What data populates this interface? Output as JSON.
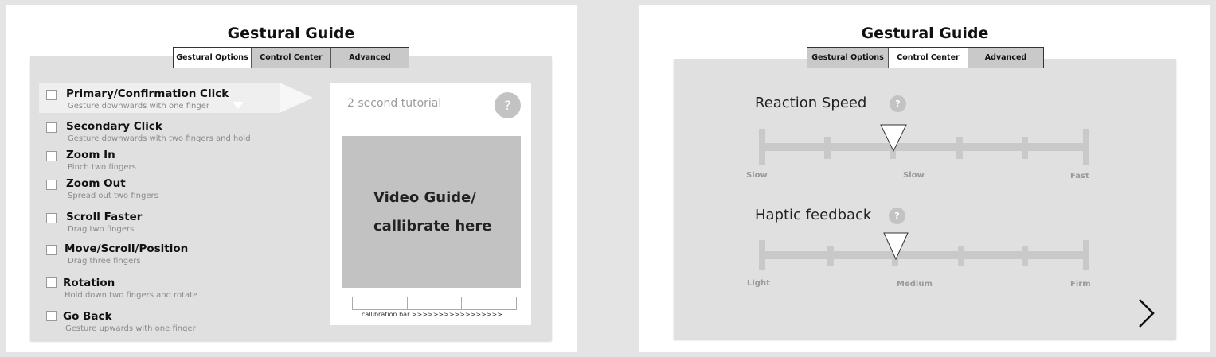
{
  "left_screen": {
    "title": "Gestural Guide",
    "tabs": [
      {
        "label": "Gestural Options",
        "active": true
      },
      {
        "label": "Control Center",
        "active": false
      },
      {
        "label": "Advanced",
        "active": false
      }
    ],
    "gestures": [
      {
        "name": "Primary/Confirmation Click",
        "desc": "Gesture downwards with one finger"
      },
      {
        "name": "Secondary Click",
        "desc": "Gesture downwards with two fingers and hold"
      },
      {
        "name": "Zoom In",
        "desc": "Pinch two fingers"
      },
      {
        "name": "Zoom Out",
        "desc": "Spread out two fingers"
      },
      {
        "name": "Scroll Faster",
        "desc": "Drag two fingers"
      },
      {
        "name": "Move/Scroll/Position",
        "desc": "Drag three fingers"
      },
      {
        "name": "Rotation",
        "desc": "Hold down two fingers and rotate"
      },
      {
        "name": "Go Back",
        "desc": "Gesture upwards with one finger"
      }
    ],
    "tutorial": {
      "label": "2 second tutorial",
      "help": "?",
      "video_line1": "Video Guide/",
      "video_line2": "callibrate here",
      "calibration_label": "callibration bar >>>>>>>>>>>>>>>>>"
    }
  },
  "right_screen": {
    "title": "Gestural Guide",
    "tabs": [
      {
        "label": "Gestural Options",
        "active": false
      },
      {
        "label": "Control Center",
        "active": true
      },
      {
        "label": "Advanced",
        "active": false
      }
    ],
    "reaction_speed": {
      "title": "Reaction Speed",
      "help": "?",
      "labels": [
        "Slow",
        "Slow",
        "Fast"
      ],
      "position": 2
    },
    "haptic_feedback": {
      "title": "Haptic feedback",
      "help": "?",
      "labels": [
        "Light",
        "Medium",
        "Firm"
      ],
      "position": 2
    }
  },
  "colors": {
    "panel": "#e0e0e0",
    "slider_track": "#c9c9c9",
    "inactive_tab": "#c9c9c9"
  }
}
